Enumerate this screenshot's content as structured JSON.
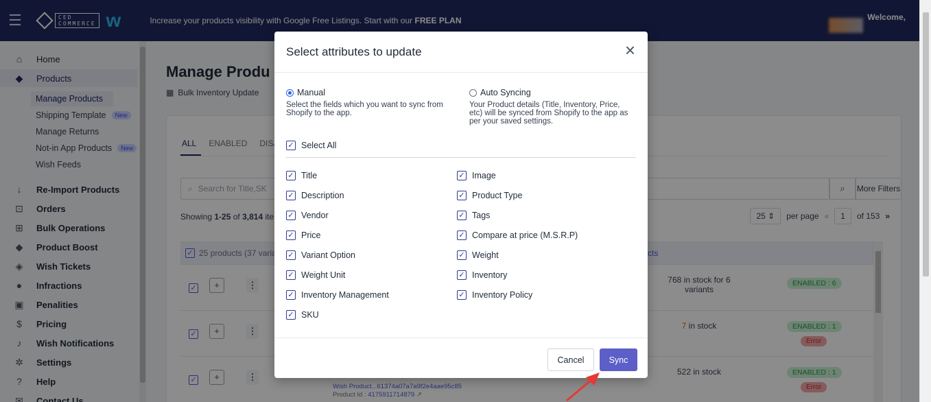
{
  "topbar": {
    "logo_text": "CED COMMERCE",
    "banner_text": "Increase your products visibility with Google Free Listings. Start with our ",
    "banner_bold": "FREE PLAN",
    "welcome": "Welcome,"
  },
  "sidebar": {
    "items": [
      {
        "label": "Home",
        "icon": "home-icon"
      },
      {
        "label": "Products",
        "icon": "tag-icon"
      },
      {
        "label": "Re-Import Products",
        "icon": "download-arrow-icon"
      },
      {
        "label": "Orders",
        "icon": "orders-icon"
      },
      {
        "label": "Bulk Operations",
        "icon": "grid-plus-icon"
      },
      {
        "label": "Product Boost",
        "icon": "tag-icon"
      },
      {
        "label": "Wish Tickets",
        "icon": "ticket-icon"
      },
      {
        "label": "Infractions",
        "icon": "alert-icon"
      },
      {
        "label": "Penalities",
        "icon": "penalty-icon"
      },
      {
        "label": "Pricing",
        "icon": "dollar-icon"
      },
      {
        "label": "Wish Notifications",
        "icon": "bell-icon"
      },
      {
        "label": "Settings",
        "icon": "gear-icon"
      },
      {
        "label": "Help",
        "icon": "help-icon"
      },
      {
        "label": "Contact Us",
        "icon": "contact-icon"
      }
    ],
    "sub_items": [
      {
        "label": "Manage Products"
      },
      {
        "label": "Shipping Template",
        "badge": "New"
      },
      {
        "label": "Manage Returns"
      },
      {
        "label": "Not-in App Products",
        "badge": "New"
      },
      {
        "label": "Wish Feeds"
      }
    ]
  },
  "main": {
    "title": "Manage Produ",
    "bulk_link": "Bulk Inventory Update",
    "tabs": [
      "ALL",
      "ENABLED",
      "DISA"
    ],
    "search_placeholder": "Search for Title,SK",
    "more_filters": "More Filters",
    "showing_prefix": "Showing ",
    "showing_range": "1-25",
    "showing_of": " of ",
    "showing_total": "3,814",
    "showing_suffix": " ite",
    "per_page_value": "25",
    "per_page_label": "per page",
    "page_first": "«",
    "page_current": "1",
    "page_total": "of 153",
    "page_last": "»",
    "select_bar": "25 products (37 varia",
    "select_bar_right": "cts",
    "rows": [
      {
        "stock": "768 in stock for 6 variants",
        "status": "ENABLED : 6",
        "error": ""
      },
      {
        "stock_num": "7",
        "stock": " in stock",
        "status": "ENABLED : 1",
        "error": "Error"
      },
      {
        "stock": "522 in stock",
        "status": "ENABLED : 1",
        "error": "Error",
        "meta1": "Wish Product...61374a07a7a9f2e4aae95c85",
        "meta2_label": "Product Id :",
        "meta2_value": "4175911714879"
      }
    ]
  },
  "modal": {
    "title": "Select attributes to update",
    "manual_label": "Manual",
    "manual_desc": "Select the fields which you want to sync from Shopify to the app.",
    "auto_label": "Auto Syncing",
    "auto_desc": "Your Product details (Title, Inventory, Price, etc) will be synced from Shopify to the app as per your saved settings.",
    "select_all": "Select All",
    "left_fields": [
      "Title",
      "Description",
      "Vendor",
      "Price",
      "Variant Option",
      "Weight Unit",
      "Inventory Management",
      "SKU"
    ],
    "right_fields": [
      "Image",
      "Product Type",
      "Tags",
      "Compare at price (M.S.R.P)",
      "Weight",
      "Inventory",
      "Inventory Policy"
    ],
    "cancel": "Cancel",
    "sync": "Sync"
  },
  "colors": {
    "topbar": "#1f2860",
    "accent": "#5b5fc7",
    "arrow": "#e53935"
  }
}
